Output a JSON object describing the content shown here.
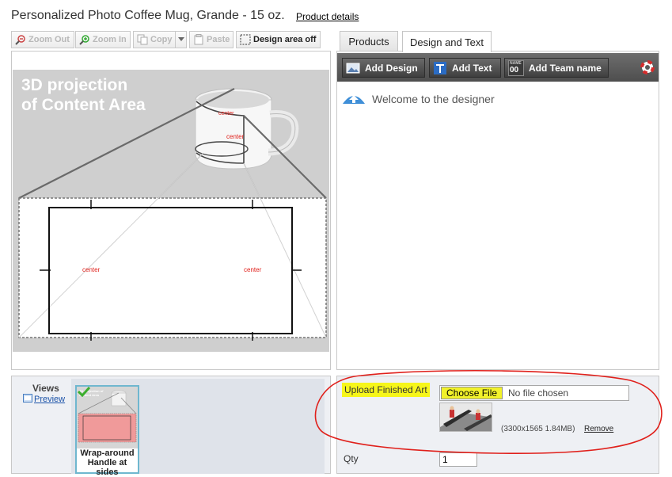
{
  "header": {
    "title": "Personalized Photo Coffee Mug, Grande - 15 oz.",
    "product_details_link": "Product details"
  },
  "toolbar": {
    "zoom_out": "Zoom Out",
    "zoom_in": "Zoom In",
    "copy": "Copy",
    "paste": "Paste",
    "design_area": "Design area off"
  },
  "tabs": [
    {
      "label": "Products",
      "selected": false
    },
    {
      "label": "Design and Text",
      "selected": true
    }
  ],
  "preview": {
    "overlay_title_line1": "3D projection",
    "overlay_title_line2": "of Content Area",
    "mug_label_top": "center",
    "mug_label_body": "center",
    "flat_label_left": "center",
    "flat_label_right": "center"
  },
  "designer": {
    "buttons": [
      {
        "label": "Add Design",
        "icon": "image-icon"
      },
      {
        "label": "Add Text",
        "icon": "text-icon"
      },
      {
        "label": "Add Team name",
        "icon": "team-name-icon"
      }
    ],
    "badge_small": "NAME",
    "badge_number": "00",
    "help_icon": "lifebuoy-icon",
    "welcome": "Welcome to the designer"
  },
  "views": {
    "label": "Views",
    "preview_link": "Preview",
    "thumb_mini_title": "3D projection of Content Area",
    "items": [
      {
        "caption": "Wrap-around Handle at sides",
        "selected": true
      }
    ]
  },
  "upload": {
    "label": "Upload Finished Art",
    "choose_file": "Choose File",
    "file_status": "No file chosen",
    "file_meta": "(3300x1565 1.84MB)",
    "remove": "Remove",
    "qty_label": "Qty",
    "qty_value": "1"
  },
  "colors": {
    "highlight_yellow": "#f6f61a",
    "annotation_red": "#e0201b",
    "toolbar_dark": "#4e4e4e",
    "selected_thumb_border": "#6fb7cf",
    "check_green": "#3cae2e"
  }
}
